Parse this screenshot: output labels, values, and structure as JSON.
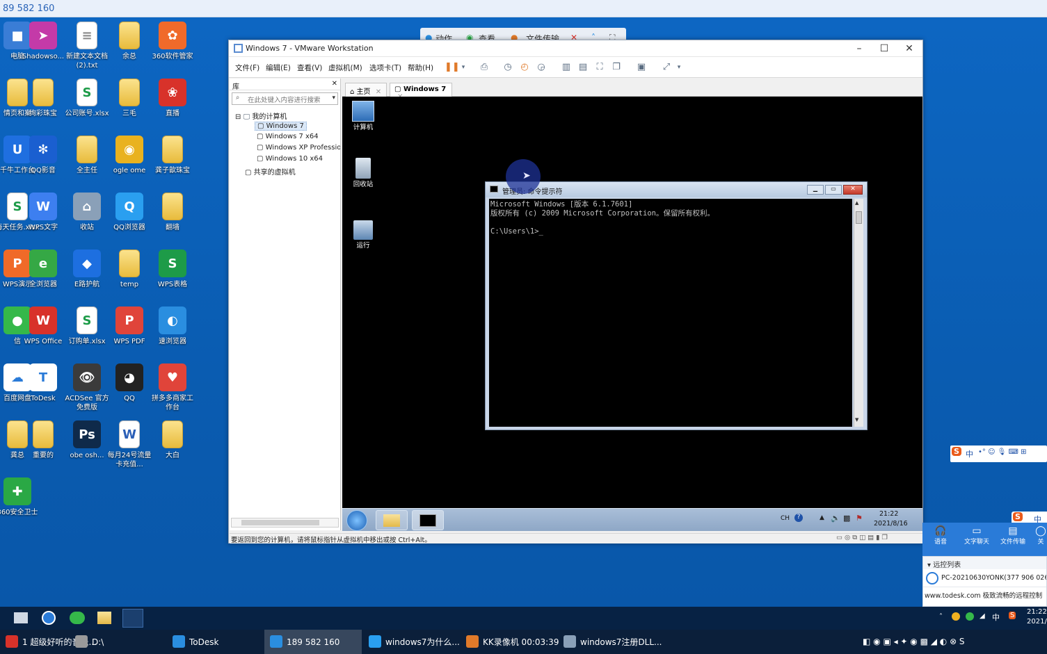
{
  "top_bar": {
    "text": "89 582 160"
  },
  "desktop_icons": [
    {
      "label": "电脑",
      "kind": "pc",
      "color": "#3a7dd6",
      "glyph": "■"
    },
    {
      "label": "Shadowso...",
      "kind": "app",
      "color": "#c43aa8",
      "glyph": "➤"
    },
    {
      "label": "新建文本文档 (2).txt",
      "kind": "doc",
      "color": "#ffffff",
      "glyph": "≡"
    },
    {
      "label": "余总",
      "kind": "folder",
      "color": "#f2cf62",
      "glyph": ""
    },
    {
      "label": "360软件管家",
      "kind": "app",
      "color": "#f06a2a",
      "glyph": "✿"
    },
    {
      "label": "情页和案",
      "kind": "folder",
      "color": "#f2cf62",
      "glyph": ""
    },
    {
      "label": "绚彩珠宝",
      "kind": "folder",
      "color": "#f2cf62",
      "glyph": ""
    },
    {
      "label": "公司账号.xlsx",
      "kind": "docs",
      "color": "#ffffff",
      "glyph": "S"
    },
    {
      "label": "三毛",
      "kind": "folder",
      "color": "#f2cf62",
      "glyph": ""
    },
    {
      "label": "直播",
      "kind": "app",
      "color": "#d8322a",
      "glyph": "❀"
    },
    {
      "label": "千牛工作台",
      "kind": "app",
      "color": "#1f6fe0",
      "glyph": "U"
    },
    {
      "label": "QQ影音",
      "kind": "app",
      "color": "#1a5fd0",
      "glyph": "✻"
    },
    {
      "label": "全主任",
      "kind": "folder",
      "color": "#f2cf62",
      "glyph": ""
    },
    {
      "label": "ogle ome",
      "kind": "app",
      "color": "#e9b21f",
      "glyph": "◉"
    },
    {
      "label": "龚子歆珠宝",
      "kind": "folder",
      "color": "#f2cf62",
      "glyph": ""
    },
    {
      "label": "每天任务.xlsx",
      "kind": "docs",
      "color": "#ffffff",
      "glyph": "S"
    },
    {
      "label": "WPS文字",
      "kind": "app",
      "color": "#3d7ff0",
      "glyph": "W"
    },
    {
      "label": "收站",
      "kind": "app",
      "color": "#8aa0b8",
      "glyph": "⌂"
    },
    {
      "label": "QQ浏览器",
      "kind": "app",
      "color": "#2a9ff0",
      "glyph": "Q"
    },
    {
      "label": "翻墙",
      "kind": "folder",
      "color": "#f2cf62",
      "glyph": ""
    },
    {
      "label": "WPS演示",
      "kind": "app",
      "color": "#f06a28",
      "glyph": "P"
    },
    {
      "label": "全浏览器",
      "kind": "app",
      "color": "#35a845",
      "glyph": "e"
    },
    {
      "label": "E路护航",
      "kind": "app",
      "color": "#1d6fe0",
      "glyph": "◆"
    },
    {
      "label": "temp",
      "kind": "folder",
      "color": "#f2cf62",
      "glyph": ""
    },
    {
      "label": "WPS表格",
      "kind": "app",
      "color": "#1d9b48",
      "glyph": "S"
    },
    {
      "label": "信",
      "kind": "app",
      "color": "#35b84a",
      "glyph": "●"
    },
    {
      "label": "WPS Office",
      "kind": "app",
      "color": "#d8322a",
      "glyph": "W"
    },
    {
      "label": "订购单.xlsx",
      "kind": "docs",
      "color": "#ffffff",
      "glyph": "S"
    },
    {
      "label": "WPS PDF",
      "kind": "app",
      "color": "#e0443a",
      "glyph": "P"
    },
    {
      "label": "速浏览器",
      "kind": "app",
      "color": "#2a8ee0",
      "glyph": "◐"
    },
    {
      "label": "百度网盘",
      "kind": "app",
      "color": "#ffffff",
      "glyph": "☁"
    },
    {
      "label": "ToDesk",
      "kind": "app",
      "color": "#ffffff",
      "glyph": "T"
    },
    {
      "label": "ACDSee 官方免费版",
      "kind": "app",
      "color": "#3b3b3b",
      "glyph": "👁"
    },
    {
      "label": "QQ",
      "kind": "app",
      "color": "#222222",
      "glyph": "◕"
    },
    {
      "label": "拼多多商家工作台",
      "kind": "app",
      "color": "#e0443a",
      "glyph": "♥"
    },
    {
      "label": "龚总",
      "kind": "folder",
      "color": "#f2cf62",
      "glyph": ""
    },
    {
      "label": "重要的",
      "kind": "folder",
      "color": "#f2cf62",
      "glyph": ""
    },
    {
      "label": "obe osh...",
      "kind": "app",
      "color": "#0f2a4a",
      "glyph": "Ps"
    },
    {
      "label": "每月24号流量卡充值...",
      "kind": "docw",
      "color": "#ffffff",
      "glyph": "W"
    },
    {
      "label": "大白",
      "kind": "folder",
      "color": "#f2cf62",
      "glyph": ""
    },
    {
      "label": "360安全卫士",
      "kind": "app",
      "color": "#2aa845",
      "glyph": "✚"
    }
  ],
  "remote_controls": {
    "action": "动作",
    "view": "查看",
    "file_transfer": "文件传输"
  },
  "vmware": {
    "title": "Windows 7 - VMware Workstation",
    "menu": [
      "文件(F)",
      "编辑(E)",
      "查看(V)",
      "虚拟机(M)",
      "选项卡(T)",
      "帮助(H)"
    ],
    "library": {
      "title": "库",
      "search_placeholder": "在此处键入内容进行搜索",
      "tree_root": "我的计算机",
      "vms": [
        "Windows 7",
        "Windows 7 x64",
        "Windows XP Professio",
        "Windows 10 x64"
      ],
      "shared": "共享的虚拟机"
    },
    "tabs": [
      {
        "label": "主页"
      },
      {
        "label": "Windows 7"
      }
    ],
    "guest": {
      "desktop_labels": [
        "计算机",
        "回收站",
        "运行"
      ],
      "cmd": {
        "title": "管理员: 命令提示符",
        "line1": "Microsoft Windows [版本 6.1.7601]",
        "line2": "版权所有 (c) 2009 Microsoft Corporation。保留所有权利。",
        "line3": "C:\\Users\\1>_"
      },
      "taskbar": {
        "lang": "CH",
        "time": "21:22",
        "date": "2021/8/16"
      }
    },
    "status_text": "要返回到您的计算机，请将鼠标指针从虚拟机中移出或按 Ctrl+Alt。"
  },
  "todesk_panel": {
    "ime": "中",
    "tools": [
      "语音",
      "文字聊天",
      "文件传输",
      "关"
    ],
    "remote_list_title": "远控列表",
    "device": "PC-20210630YONK(377 906 026",
    "footer": "www.todesk.com 极致流畅的远程控制"
  },
  "host_taskbar": {
    "tray_ime": "中",
    "time": "21:22",
    "date": "2021/",
    "buttons": [
      {
        "label": "1 超级好听的音乐...",
        "color": "#d8322a"
      },
      {
        "label": "D:\\",
        "color": "#9a9a9a"
      },
      {
        "label": "ToDesk",
        "color": "#2a8ee0"
      },
      {
        "label": "189 582 160",
        "color": "#2a8ee0"
      },
      {
        "label": "windows7为什么...",
        "color": "#2a9ff0"
      },
      {
        "label": "KK录像机 00:03:39",
        "color": "#e07a2a"
      },
      {
        "label": "windows7注册DLL...",
        "color": "#8aa0b8"
      }
    ]
  }
}
